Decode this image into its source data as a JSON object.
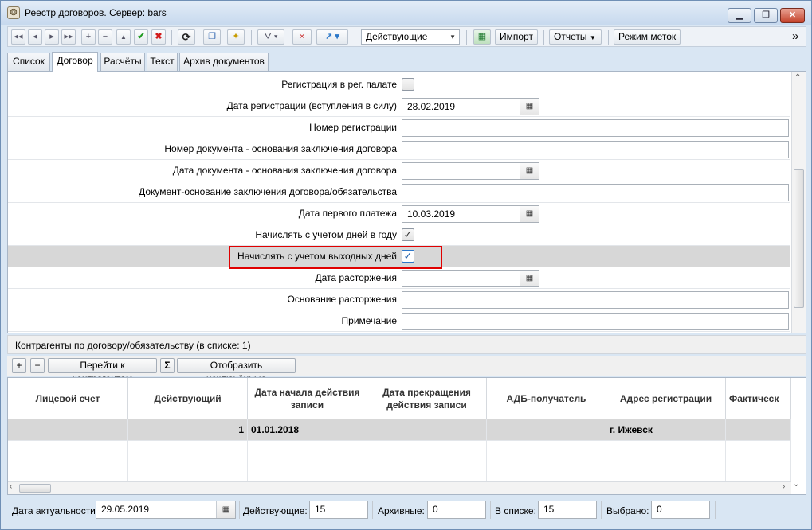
{
  "window": {
    "title": "Реестр договоров. Сервер: bars",
    "min_label": "▁",
    "max_label": "❐",
    "close_label": "✕"
  },
  "toolbar": {
    "status_combo": "Действующие",
    "import_label": "Импорт",
    "reports_label": "Отчеты",
    "marks_mode_label": "Режим меток",
    "overflow_label": "»",
    "icons": {
      "first": "◂◂",
      "prev": "◂",
      "next": "▸",
      "last": "▸▸",
      "add": "+",
      "remove": "−",
      "up": "▲",
      "save": "✔",
      "cancel": "✖",
      "refresh": "⟳",
      "copy": "❐",
      "wizard": "✦",
      "filter": "⛛",
      "clear_filter": "⨯",
      "jump": "↗",
      "excel": "▦"
    }
  },
  "tabs": [
    "Список",
    "Договор",
    "Расчёты",
    "Текст",
    "Архив документов"
  ],
  "active_tab": "Договор",
  "form": {
    "rows": [
      {
        "label": "Регистрация в рег. палате",
        "type": "checkbox",
        "checked": false
      },
      {
        "label": "Дата регистрации (вступления в силу)",
        "type": "date",
        "value": "28.02.2019"
      },
      {
        "label": "Номер регистрации",
        "type": "text",
        "value": ""
      },
      {
        "label": "Номер документа - основания заключения договора",
        "type": "text",
        "value": ""
      },
      {
        "label": "Дата документа - основания заключения договора",
        "type": "date",
        "value": ""
      },
      {
        "label": "Документ-основание заключения договора/обязательства",
        "type": "text",
        "value": ""
      },
      {
        "label": "Дата первого платежа",
        "type": "date",
        "value": "10.03.2019"
      },
      {
        "label": "Начислять с учетом  дней в году",
        "type": "checkbox",
        "checked": true
      },
      {
        "label": "Начислять с учетом выходных дней",
        "type": "checkbox",
        "checked": true
      },
      {
        "label": "Дата расторжения",
        "type": "date",
        "value": ""
      },
      {
        "label": "Основание расторжения",
        "type": "text",
        "value": ""
      },
      {
        "label": "Примечание",
        "type": "text",
        "value": ""
      }
    ],
    "check_glyph": "✓",
    "calendar_glyph": "▦"
  },
  "counterparties": {
    "section_title": "Контрагенты по договору/обязательству (в списке: 1)",
    "add_label": "+",
    "remove_label": "−",
    "go_label": "Перейти к контрагентам",
    "sum_label": "Σ",
    "show_excluded_label": "Отобразить исключённые",
    "columns": [
      "Лицевой счет",
      "Действующий",
      "Дата начала действия записи",
      "Дата прекращения действия записи",
      "АДБ-получатель",
      "Адрес регистрации",
      "Фактическ"
    ],
    "rows": [
      [
        "",
        "1",
        "01.01.2018",
        "",
        "",
        "г. Ижевск",
        ""
      ]
    ]
  },
  "status": {
    "actuality_label": "Дата актуальности",
    "actuality_value": "29.05.2019",
    "active_label": "Действующие:",
    "active_value": "15",
    "archive_label": "Архивные:",
    "archive_value": "0",
    "in_list_label": "В списке:",
    "in_list_value": "15",
    "selected_label": "Выбрано:",
    "selected_value": "0"
  }
}
